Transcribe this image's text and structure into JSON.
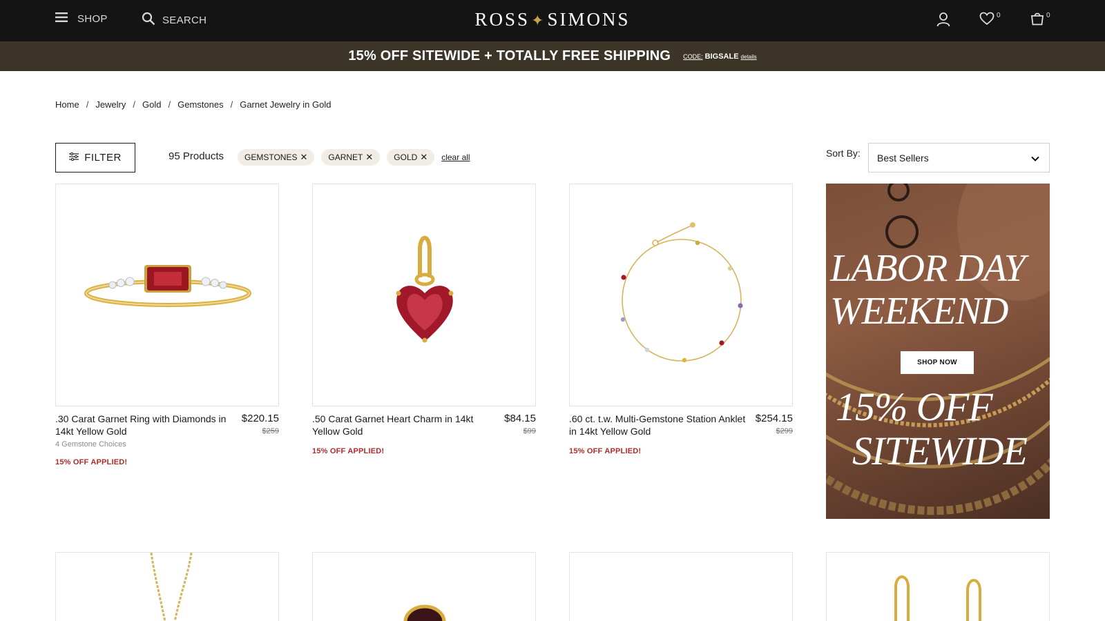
{
  "header": {
    "shop_label": "SHOP",
    "search_label": "SEARCH",
    "logo_text": "ROSS",
    "logo_text_2": "SIMONS",
    "wishlist_count": "0",
    "bag_count": "0"
  },
  "promo": {
    "headline": "15% OFF SITEWIDE + TOTALLY FREE SHIPPING",
    "code_label": "CODE:",
    "code_value": "BIGSALE",
    "details_label": "details"
  },
  "breadcrumb": [
    "Home",
    "Jewelry",
    "Gold",
    "Gemstones",
    "Garnet Jewelry in Gold"
  ],
  "toolbar": {
    "filter_label": "FILTER",
    "product_count": "95 Products",
    "chips": [
      "GEMSTONES",
      "GARNET",
      "GOLD"
    ],
    "clear_all": "clear all",
    "sort_label": "Sort By:",
    "sort_value": "Best Sellers"
  },
  "products": [
    {
      "name": ".30 Carat Garnet Ring with Diamonds in 14kt Yellow Gold",
      "price": "$220.15",
      "original_price": "$259",
      "choices": "4 Gemstone Choices",
      "applied": "15% OFF APPLIED!"
    },
    {
      "name": ".50 Carat Garnet Heart Charm in 14kt Yellow Gold",
      "price": "$84.15",
      "original_price": "$99",
      "applied": "15% OFF APPLIED!"
    },
    {
      "name": ".60 ct. t.w. Multi-Gemstone Station Anklet in 14kt Yellow Gold",
      "price": "$254.15",
      "original_price": "$299",
      "applied": "15% OFF APPLIED!"
    }
  ],
  "banner": {
    "line1": "LABOR DAY",
    "line2": "WEEKEND",
    "button": "SHOP NOW",
    "line3": "15% OFF",
    "line4": "SITEWIDE"
  },
  "colors": {
    "header_bg": "#141414",
    "promo_bg": "#3c3427",
    "sale_red": "#b22a2a",
    "gold": "#c9a24a"
  }
}
